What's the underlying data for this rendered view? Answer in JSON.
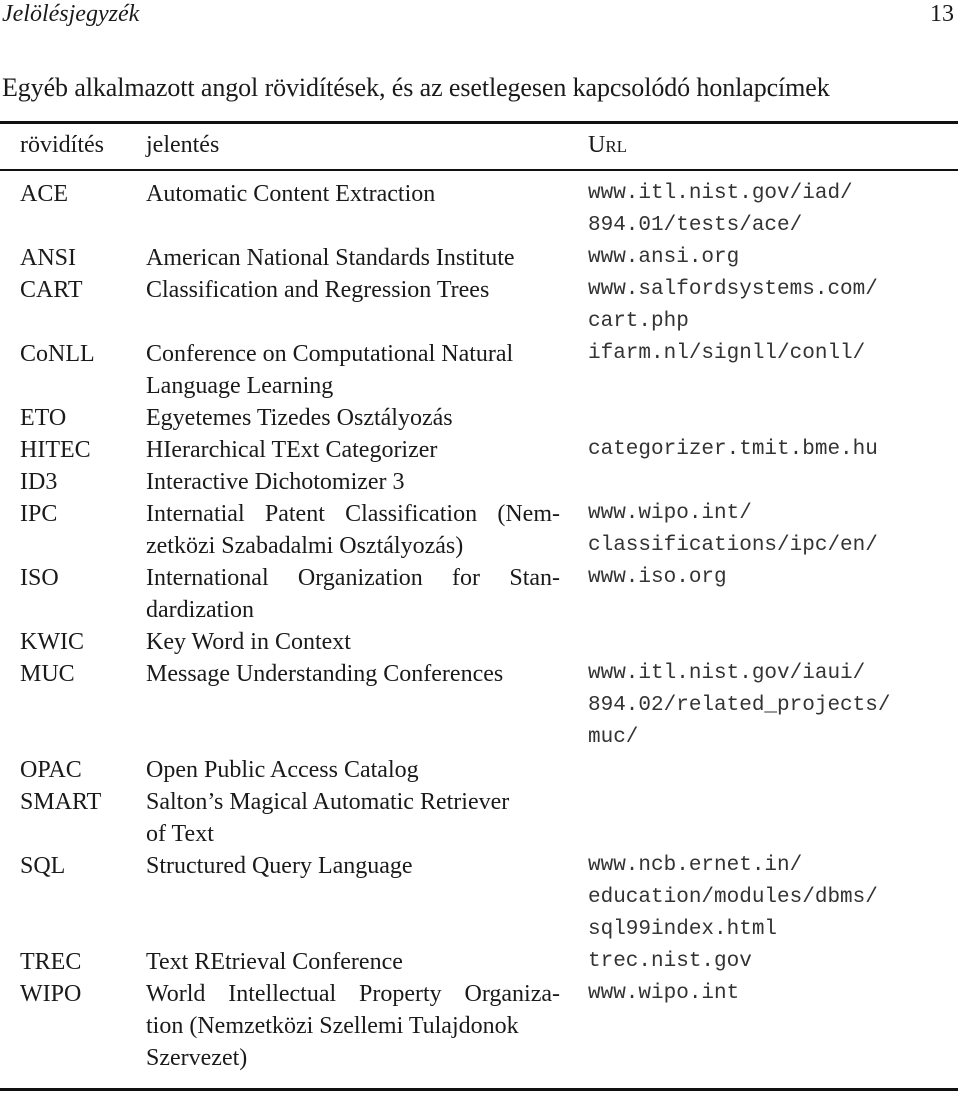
{
  "running_head": "Jelölésjegyzék",
  "page_number": "13",
  "section_title": "Egyéb alkalmazott angol rövidítések, és az esetlegesen kapcsolódó honlapcímek",
  "table": {
    "headers": {
      "abbr": "rövidítés",
      "meaning": "jelentés",
      "url": "Url"
    },
    "rows": [
      {
        "abbr": "ACE",
        "meaning": [
          "Automatic Content Extraction"
        ],
        "url": [
          "www.itl.nist.gov/iad/",
          "894.01/tests/ace/"
        ]
      },
      {
        "abbr": "ANSI",
        "meaning": [
          "American National Standards Institute"
        ],
        "url": [
          "www.ansi.org"
        ]
      },
      {
        "abbr": "CART",
        "meaning": [
          "Classification and Regression Trees"
        ],
        "url": [
          "www.salfordsystems.com/",
          "cart.php"
        ]
      },
      {
        "abbr": "CoNLL",
        "meaning": [
          "Conference on Computational Natural",
          "Language Learning"
        ],
        "url": [
          "ifarm.nl/signll/conll/"
        ]
      },
      {
        "abbr": "ETO",
        "meaning": [
          "Egyetemes Tizedes Osztályozás"
        ],
        "url": []
      },
      {
        "abbr": "HITEC",
        "meaning": [
          "HIerarchical TExt Categorizer"
        ],
        "url": [
          "categorizer.tmit.bme.hu"
        ]
      },
      {
        "abbr": "ID3",
        "meaning": [
          "Interactive Dichotomizer 3"
        ],
        "url": []
      },
      {
        "abbr": "IPC",
        "meaning": [
          "Internatial Patent Classification (Nem-",
          "zetközi Szabadalmi Osztályozás)"
        ],
        "url": [
          "www.wipo.int/",
          "classifications/ipc/en/"
        ]
      },
      {
        "abbr": "ISO",
        "meaning": [
          "International Organization for Stan-",
          "dardization"
        ],
        "url": [
          "www.iso.org"
        ]
      },
      {
        "abbr": "KWIC",
        "meaning": [
          "Key Word in Context"
        ],
        "url": []
      },
      {
        "abbr": "MUC",
        "meaning": [
          "Message Understanding Conferences"
        ],
        "url": [
          "www.itl.nist.gov/iaui/",
          "894.02/related_projects/",
          "muc/"
        ]
      },
      {
        "abbr": "OPAC",
        "meaning": [
          "Open Public Access Catalog"
        ],
        "url": []
      },
      {
        "abbr": "SMART",
        "meaning": [
          "Salton’s Magical Automatic Retriever",
          "of Text"
        ],
        "url": []
      },
      {
        "abbr": "SQL",
        "meaning": [
          "Structured Query Language"
        ],
        "url": [
          "www.ncb.ernet.in/",
          "education/modules/dbms/",
          "sql99index.html"
        ]
      },
      {
        "abbr": "TREC",
        "meaning": [
          "Text REtrieval Conference"
        ],
        "url": [
          "trec.nist.gov"
        ]
      },
      {
        "abbr": "WIPO",
        "meaning": [
          "World Intellectual Property Organiza-",
          "tion (Nemzetközi Szellemi Tulajdonok",
          "Szervezet)"
        ],
        "url": [
          "www.wipo.int"
        ]
      }
    ]
  }
}
